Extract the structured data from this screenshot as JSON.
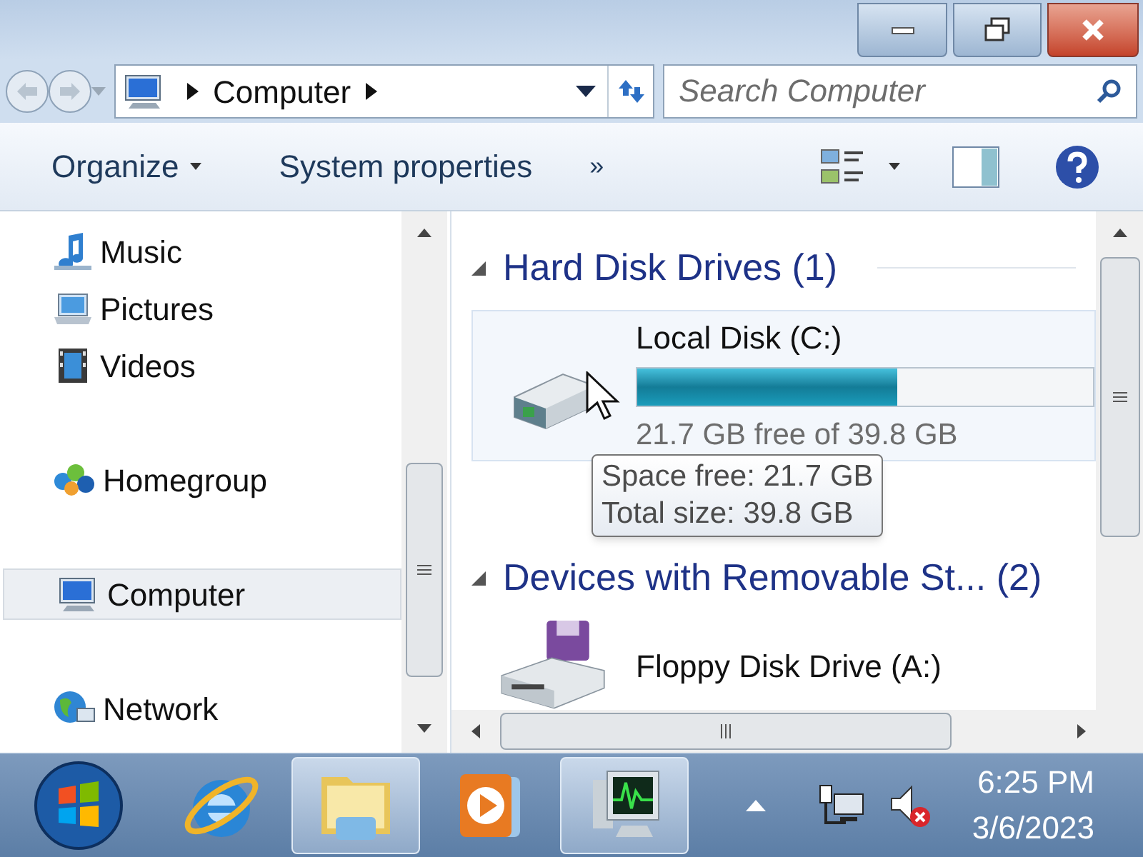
{
  "address": {
    "crumbs": [
      "Computer"
    ]
  },
  "search": {
    "placeholder": "Search Computer"
  },
  "toolbar": [
    {
      "label": "Organize",
      "kind": "menu"
    },
    {
      "label": "System properties",
      "kind": "button"
    },
    {
      "label": "»",
      "kind": "more"
    }
  ],
  "nav": [
    {
      "label": "Music",
      "kind": "music",
      "selected": false
    },
    {
      "label": "Pictures",
      "kind": "pictures",
      "selected": false
    },
    {
      "label": "Videos",
      "kind": "videos",
      "selected": false
    },
    {
      "label": "Homegroup",
      "kind": "homegroup",
      "selected": false
    },
    {
      "label": "Computer",
      "kind": "computer",
      "selected": true
    },
    {
      "label": "Network",
      "kind": "network",
      "selected": false
    }
  ],
  "groups": [
    {
      "title": "Hard Disk Drives (1)",
      "expanded": true,
      "items": [
        {
          "name": "Local Disk (C:)",
          "kind": "disk",
          "hover": true,
          "level": 0.57,
          "detail": "21.7 GB free of 39.8 GB"
        }
      ]
    },
    {
      "title": "Devices with Removable St... (2)",
      "expanded": true,
      "items": [
        {
          "name": "Floppy Disk Drive (A:)",
          "kind": "floppy",
          "hover": false
        }
      ]
    }
  ],
  "tooltip": {
    "lines": [
      "Space free: 21.7 GB",
      "Total size: 39.8 GB"
    ]
  },
  "taskbar": {
    "apps": [
      {
        "kind": "browser",
        "selected": false
      },
      {
        "kind": "explorer",
        "selected": true
      },
      {
        "kind": "player",
        "selected": false
      },
      {
        "kind": "monitor",
        "selected": true
      }
    ],
    "volume_muted": true,
    "time": "6:25 PM",
    "date": "3/6/2023"
  }
}
